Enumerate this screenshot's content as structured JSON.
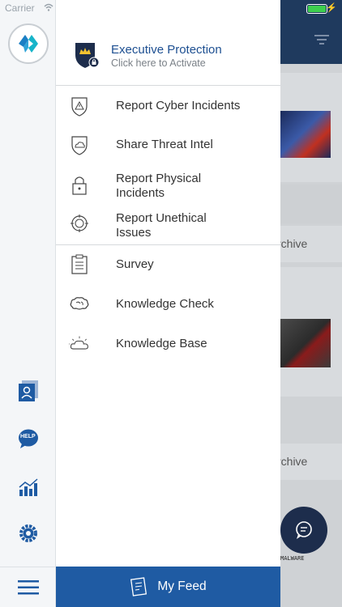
{
  "status_bar": {
    "carrier": "Carrier"
  },
  "executive": {
    "title": "Executive Protection",
    "subtitle": "Click here to Activate"
  },
  "menu": {
    "report_cyber": "Report Cyber Incidents",
    "share_threat": "Share Threat Intel",
    "report_physical_1": "Report Physical",
    "report_physical_2": "Incidents",
    "report_unethical_1": "Report Unethical",
    "report_unethical_2": "Issues",
    "survey": "Survey",
    "knowledge_check": "Knowledge Check",
    "knowledge_base": "Knowledge Base"
  },
  "footer": {
    "label": "My Feed"
  },
  "background": {
    "archive_1": "rchive",
    "archive_2": "rchive",
    "malware": "MALWARE"
  },
  "rail": {
    "help_label": "HELP"
  },
  "colors": {
    "brand": "#1f5ba3",
    "rail_icon": "#1f5ba3",
    "header_bg": "#1f3a5e"
  }
}
